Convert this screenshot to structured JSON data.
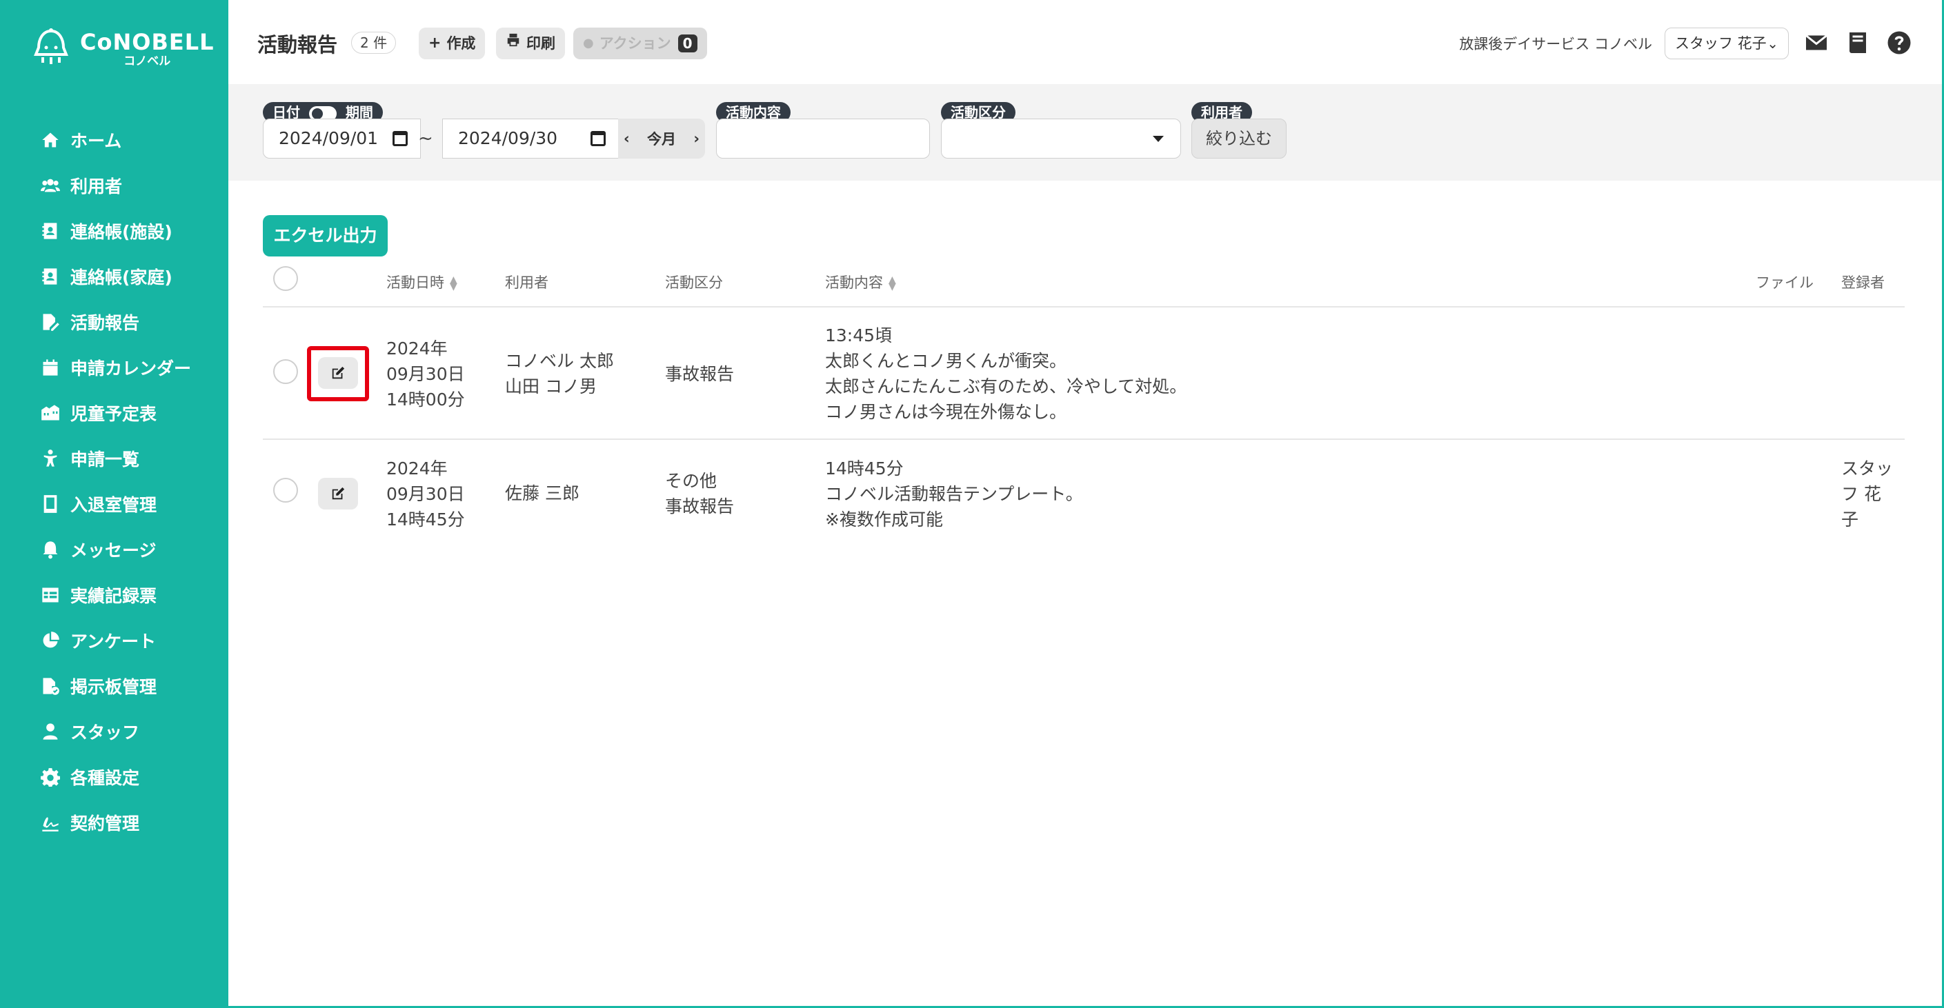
{
  "app": {
    "logo_main": "CoNOBELL",
    "logo_sub": "コノベル"
  },
  "sidebar": {
    "items": [
      {
        "label": "ホーム",
        "icon": "home-icon"
      },
      {
        "label": "利用者",
        "icon": "users-icon"
      },
      {
        "label": "連絡帳(施設)",
        "icon": "contact-book-icon"
      },
      {
        "label": "連絡帳(家庭)",
        "icon": "contact-book-icon"
      },
      {
        "label": "活動報告",
        "icon": "file-edit-icon"
      },
      {
        "label": "申請カレンダー",
        "icon": "calendar-icon"
      },
      {
        "label": "児童予定表",
        "icon": "schedule-icon"
      },
      {
        "label": "申請一覧",
        "icon": "child-icon"
      },
      {
        "label": "入退室管理",
        "icon": "tablet-icon"
      },
      {
        "label": "メッセージ",
        "icon": "bell-icon"
      },
      {
        "label": "実績記録票",
        "icon": "table-icon"
      },
      {
        "label": "アンケート",
        "icon": "pie-chart-icon"
      },
      {
        "label": "掲示板管理",
        "icon": "board-icon"
      },
      {
        "label": "スタッフ",
        "icon": "staff-icon"
      },
      {
        "label": "各種設定",
        "icon": "gear-icon"
      },
      {
        "label": "契約管理",
        "icon": "signature-icon"
      }
    ]
  },
  "header": {
    "title": "活動報告",
    "count": "2 件",
    "create_label": "作成",
    "print_label": "印刷",
    "action_label": "アクション",
    "action_count": "0",
    "facility": "放課後デイサービス コノベル",
    "staff": "スタッフ 花子"
  },
  "filters": {
    "date_label": "日付",
    "period_label": "期間",
    "date_from": "2024/09/01",
    "tilde": "~",
    "date_to": "2024/09/30",
    "this_month": "今月",
    "content_label": "活動内容",
    "content_value": "",
    "category_label": "活動区分",
    "category_value": "",
    "user_label": "利用者",
    "narrow_label": "絞り込む"
  },
  "main": {
    "excel_label": "エクセル出力",
    "columns": {
      "datetime": "活動日時",
      "user": "利用者",
      "category": "活動区分",
      "content": "活動内容",
      "file": "ファイル",
      "registrant": "登録者"
    },
    "rows": [
      {
        "datetime": [
          "2024年",
          "09月30日",
          "14時00分"
        ],
        "users": [
          "コノベル 太郎",
          "山田 コノ男"
        ],
        "categories": [
          "事故報告"
        ],
        "content": [
          "13:45頃",
          "太郎くんとコノ男くんが衝突。",
          "太郎さんにたんこぶ有のため、冷やして対処。",
          "コノ男さんは今現在外傷なし。"
        ],
        "registrant": []
      },
      {
        "datetime": [
          "2024年",
          "09月30日",
          "14時45分"
        ],
        "users": [
          "佐藤 三郎"
        ],
        "categories": [
          "その他",
          "事故報告"
        ],
        "content": [
          "14時45分",
          "コノベル活動報告テンプレート。",
          "※複数作成可能"
        ],
        "registrant": [
          "スタッ",
          "フ 花",
          "子"
        ]
      }
    ]
  },
  "colors": {
    "brand": "#17b5a3",
    "highlight": "#e60012",
    "tag": "#333b45"
  }
}
